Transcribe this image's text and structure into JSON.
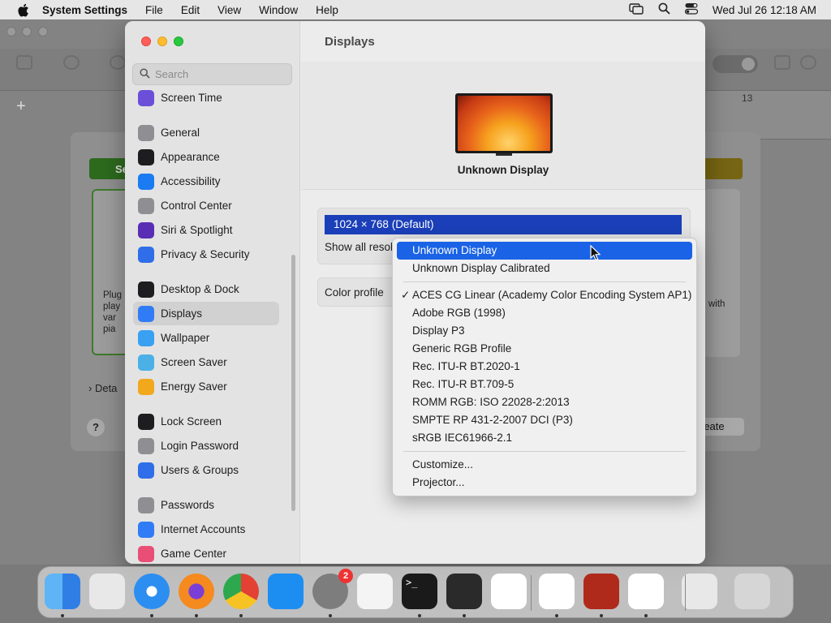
{
  "menubar": {
    "app": "System Settings",
    "items": [
      "File",
      "Edit",
      "View",
      "Window",
      "Help"
    ],
    "datetime": "Wed Jul 26  12:18 AM"
  },
  "background_app": {
    "ruler_number": "13",
    "left_label": "Se",
    "left_pane_lines": [
      "Plug",
      "play",
      "var",
      "pia"
    ],
    "right_pane_text": "with",
    "details": "Deta",
    "help": "?",
    "create": "reate"
  },
  "settings": {
    "search_placeholder": "Search",
    "sidebar": [
      {
        "label": "Screen Time",
        "icon": "hourglass-icon",
        "color": "#6b4fd8"
      },
      {
        "label": "General",
        "icon": "gear-icon",
        "color": "#8e8e93"
      },
      {
        "label": "Appearance",
        "icon": "appearance-icon",
        "color": "#1d1d1f"
      },
      {
        "label": "Accessibility",
        "icon": "accessibility-icon",
        "color": "#1a7bf2"
      },
      {
        "label": "Control Center",
        "icon": "control-center-icon",
        "color": "#8e8e93"
      },
      {
        "label": "Siri & Spotlight",
        "icon": "siri-icon",
        "color": "#5a2db5"
      },
      {
        "label": "Privacy & Security",
        "icon": "hand-icon",
        "color": "#2f6ee8"
      },
      {
        "label": "Desktop & Dock",
        "icon": "desktop-icon",
        "color": "#1d1d1f"
      },
      {
        "label": "Displays",
        "icon": "display-icon",
        "color": "#2f7cf6"
      },
      {
        "label": "Wallpaper",
        "icon": "wallpaper-icon",
        "color": "#3aa0f2"
      },
      {
        "label": "Screen Saver",
        "icon": "screen-saver-icon",
        "color": "#4bb0e6"
      },
      {
        "label": "Energy Saver",
        "icon": "lightbulb-icon",
        "color": "#f2a81d"
      },
      {
        "label": "Lock Screen",
        "icon": "lock-icon",
        "color": "#1d1d1f"
      },
      {
        "label": "Login Password",
        "icon": "login-lock-icon",
        "color": "#8e8e93"
      },
      {
        "label": "Users & Groups",
        "icon": "users-icon",
        "color": "#2f6ee8"
      },
      {
        "label": "Passwords",
        "icon": "key-icon",
        "color": "#8e8e93"
      },
      {
        "label": "Internet Accounts",
        "icon": "at-icon",
        "color": "#2f7cf6"
      },
      {
        "label": "Game Center",
        "icon": "game-center-icon",
        "color": "#e94e77"
      }
    ],
    "selected": "Displays",
    "main": {
      "title": "Displays",
      "display_name": "Unknown Display",
      "resolution": "1024 × 768 (Default)",
      "show_all": "Show all resol",
      "color_profile_label": "Color profile"
    },
    "dropdown": {
      "highlighted": "Unknown Display",
      "group1": [
        "Unknown Display",
        "Unknown Display Calibrated"
      ],
      "group2": [
        "ACES CG Linear (Academy Color Encoding System AP1)",
        "Adobe RGB (1998)",
        "Display P3",
        "Generic RGB Profile",
        "Rec. ITU-R BT.2020-1",
        "Rec. ITU-R BT.709-5",
        "ROMM RGB: ISO 22028-2:2013",
        "SMPTE RP 431-2-2007 DCI (P3)",
        "sRGB IEC61966-2.1"
      ],
      "checked": "ACES CG Linear (Academy Color Encoding System AP1)",
      "group3": [
        "Customize...",
        "Projector..."
      ],
      "check_mark": "✓"
    }
  },
  "dock": {
    "apps": [
      {
        "name": "Finder",
        "icon": "finder-icon"
      },
      {
        "name": "Launchpad",
        "icon": "launchpad-icon"
      },
      {
        "name": "Safari",
        "icon": "safari-icon"
      },
      {
        "name": "Firefox",
        "icon": "firefox-icon"
      },
      {
        "name": "Chrome",
        "icon": "chrome-icon"
      },
      {
        "name": "App Store",
        "icon": "app-store-icon"
      },
      {
        "name": "System Settings",
        "icon": "system-settings-icon",
        "badge": "2"
      },
      {
        "name": "TextEdit",
        "icon": "textedit-icon"
      },
      {
        "name": "Terminal",
        "icon": "terminal-icon",
        "glyph": ">_"
      },
      {
        "name": "GarageBand",
        "icon": "guitar-icon"
      },
      {
        "name": "VS Code",
        "icon": "vscode-icon"
      },
      {
        "name": "Visual Studio",
        "icon": "visual-studio-icon"
      },
      {
        "name": "Remote Desktop",
        "icon": "remote-desktop-icon"
      },
      {
        "name": "Freeform",
        "icon": "freeform-icon"
      },
      {
        "name": "Preview",
        "icon": "preview-icon"
      },
      {
        "name": "Trash",
        "icon": "trash-icon"
      }
    ]
  }
}
